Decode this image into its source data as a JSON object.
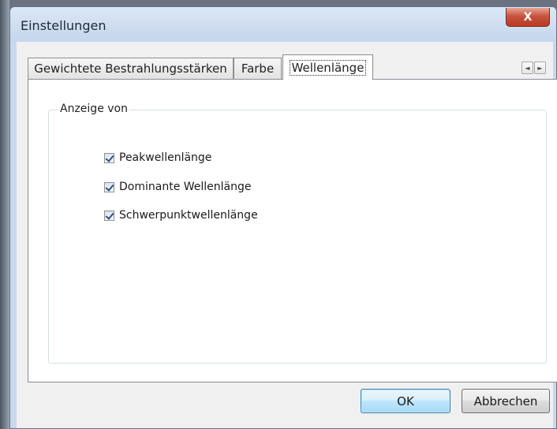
{
  "window": {
    "title": "Einstellungen",
    "close_label": "X"
  },
  "tabs": [
    {
      "label": "Gewichtete Bestrahlungsstärken",
      "active": false
    },
    {
      "label": "Farbe",
      "active": false
    },
    {
      "label": "Wellenlänge",
      "active": true
    }
  ],
  "tab_scroll": {
    "left_icon": "◄",
    "right_icon": "►"
  },
  "group": {
    "label": "Anzeige von",
    "options": [
      {
        "label": "Peakwellenlänge",
        "checked": true
      },
      {
        "label": "Dominante Wellenlänge",
        "checked": true
      },
      {
        "label": "Schwerpunktwellenlänge",
        "checked": true
      }
    ]
  },
  "buttons": {
    "ok": "OK",
    "cancel": "Abbrechen"
  },
  "colors": {
    "title_bg": "#c9d9ec",
    "close_red": "#c85340",
    "default_button": "#bee6fd"
  }
}
